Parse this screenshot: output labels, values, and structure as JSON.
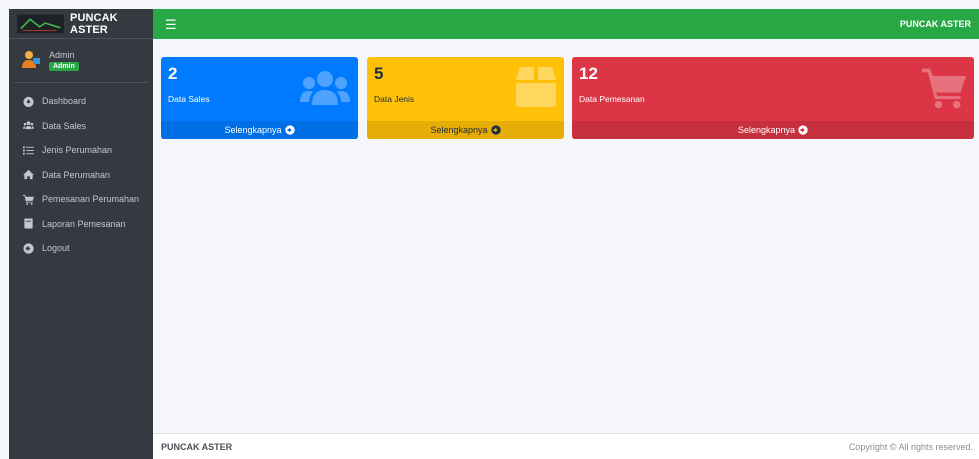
{
  "brand": {
    "title": "PUNCAK ASTER"
  },
  "user": {
    "name": "Admin",
    "role_badge": "Admin"
  },
  "sidebar": {
    "items": [
      {
        "label": "Dashboard",
        "icon": "dashboard-icon"
      },
      {
        "label": "Data Sales",
        "icon": "users-icon"
      },
      {
        "label": "Jenis Perumahan",
        "icon": "list-icon"
      },
      {
        "label": "Data Perumahan",
        "icon": "home-icon"
      },
      {
        "label": "Pemesanan Perumahan",
        "icon": "cart-icon"
      },
      {
        "label": "Laporan Pemesanan",
        "icon": "book-icon"
      },
      {
        "label": "Logout",
        "icon": "arrow-circle-icon"
      }
    ]
  },
  "topbar": {
    "menu_icon": "hamburger-icon",
    "title": "PUNCAK ASTER"
  },
  "cards": [
    {
      "count": "2",
      "label": "Data Sales",
      "link": "Selengkapnya",
      "color": "#007bff",
      "icon": "users-icon"
    },
    {
      "count": "5",
      "label": "Data Jenis",
      "link": "Selengkapnya",
      "color": "#ffc107",
      "icon": "box-icon"
    },
    {
      "count": "12",
      "label": "Data Pemesanan",
      "link": "Selengkapnya",
      "color": "#dc3545",
      "icon": "cart-icon"
    }
  ],
  "footer": {
    "left": "PUNCAK ASTER",
    "right": "Copyright © All rights reserved."
  },
  "colors": {
    "sidebar": "#343a40",
    "topbar": "#28a745",
    "content_bg": "#f4f6f9"
  }
}
